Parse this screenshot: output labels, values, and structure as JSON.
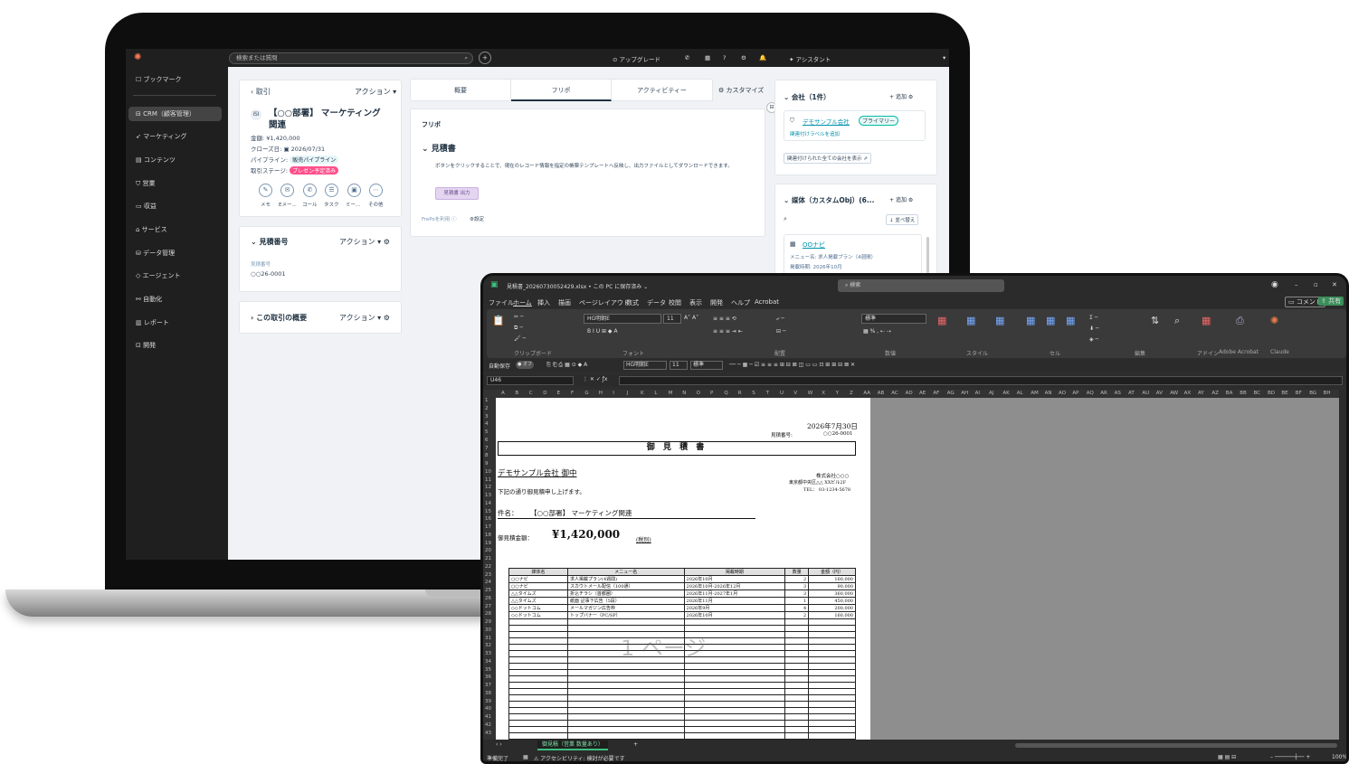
{
  "crm": {
    "search_placeholder": "検索または質問",
    "upgrade": "アップグレード",
    "assistant": "アシスタント",
    "sidebar": [
      "ブックマーク",
      "CRM（顧客管理）",
      "マーケティング",
      "コンテンツ",
      "営業",
      "収益",
      "サービス",
      "データ管理",
      "エージェント",
      "自動化",
      "レポート",
      "開発"
    ],
    "record": {
      "back": "取引",
      "action": "アクション",
      "title1": "【○○部署】 マーケティング",
      "title2": "関連",
      "amount": "金額: ¥1,420,000",
      "close_label": "クローズ日:",
      "close_date": "2026/07/31",
      "pipeline_label": "パイプライン:",
      "pipeline_value": "販売パイプライン",
      "stage_label": "取引ステージ:",
      "stage_value": "プレゼン予定済み",
      "icons": [
        "メモ",
        "Eメー...",
        "コール",
        "タスク",
        "ミー...",
        "その他"
      ]
    },
    "estimate_card": {
      "title": "見積番号",
      "action": "アクション",
      "field_label": "見積番号",
      "field_value": "○○26-0001"
    },
    "summary_card": {
      "title": "この取引の概要",
      "action": "アクション"
    },
    "tabs": [
      "概要",
      "フリポ",
      "アクティビティー"
    ],
    "customize": "カスタマイズ",
    "frepo": {
      "heading": "フリポ",
      "section": "見積書",
      "desc": "ボタンをクリックすることで、現在のレコード情報を指定の帳票テンプレートへ反映し、出力ファイルとしてダウンロードできます。",
      "button": "見積書 出力",
      "footer": "FrePoを利用",
      "settings": "設定"
    },
    "company": {
      "title": "会社（1件）",
      "add": "追加",
      "name": "デモサンプル会社",
      "badge": "プライマリー",
      "link": "関連付けラベルを追加",
      "view_all": "関連付けられた全ての会社を表示"
    },
    "media": {
      "title": "媒体（カスタムObj）(6...",
      "add": "追加",
      "sort": "並べ替え",
      "name": "OOナビ",
      "menu": "メニュー名: 求人掲載プラン（4週間）",
      "period": "掲載時期: 2026年10月"
    }
  },
  "excel": {
    "filename": "見積書_20260730052429.xlsx • この PC に保存済み",
    "search": "検索",
    "comment": "コメント",
    "share": "共有",
    "menus": [
      "ファイル",
      "ホーム",
      "挿入",
      "描画",
      "ページレイアウト",
      "数式",
      "データ",
      "校閲",
      "表示",
      "開発",
      "ヘルプ",
      "Acrobat"
    ],
    "ribbon_groups": [
      "クリップボード",
      "フォント",
      "配置",
      "数値",
      "スタイル",
      "セル",
      "編集",
      "アドイン",
      "Adobe Acrobat",
      "Claude"
    ],
    "font_name": "HG明朝E",
    "font_size": "11",
    "number_format": "標準",
    "cell_ref": "U46",
    "autosave": "自動保存",
    "doc": {
      "date": "2026年7月30日",
      "est_no_label": "見積番号:",
      "est_no": "○○26-0001",
      "title": "御 見 積 書",
      "customer": "デモサンプル会社 御中",
      "greeting": "下記の通り御見積申し上げます。",
      "issuer": "株式会社○○○",
      "address": "東京都中央区△△ XXビル2F",
      "tel": "TEL： 03-1234-5678",
      "subject_label": "件名：",
      "subject": "【○○部署】 マーケティング関連",
      "amount_label": "御見積金額：",
      "amount": "¥1,420,000",
      "tax": "(税別)",
      "watermark": "1 ページ"
    },
    "table": {
      "headers": [
        "媒体名",
        "メニュー名",
        "掲載時期",
        "数量",
        "金額（円）"
      ],
      "rows": [
        [
          "○○ナビ",
          "求人掲載プラン(4週間)",
          "2026年10月",
          "2",
          "160,000"
        ],
        [
          "○○ナビ",
          "スカウトメール配信（100通）",
          "2026年10月-2026年12月",
          "3",
          "90,000"
        ],
        [
          "△△タイムズ",
          "折込チラシ（首都圏）",
          "2026年11月-2027年1月",
          "3",
          "360,000"
        ],
        [
          "△△タイムズ",
          "紙面 記事下広告（5段）",
          "2026年11月",
          "1",
          "450,000"
        ],
        [
          "◇◇ドットコム",
          "メールマガジン広告枠",
          "2026年9月",
          "4",
          "200,000"
        ],
        [
          "◇◇ドットコム",
          "トップバナー（PC/SP）",
          "2026年10月",
          "2",
          "160,000"
        ]
      ]
    },
    "sheet_tab": "御見積（営業 数量あり）",
    "status": "準備完了",
    "accessibility": "アクセシビリティ: 検討が必要です",
    "zoom": "100%"
  }
}
